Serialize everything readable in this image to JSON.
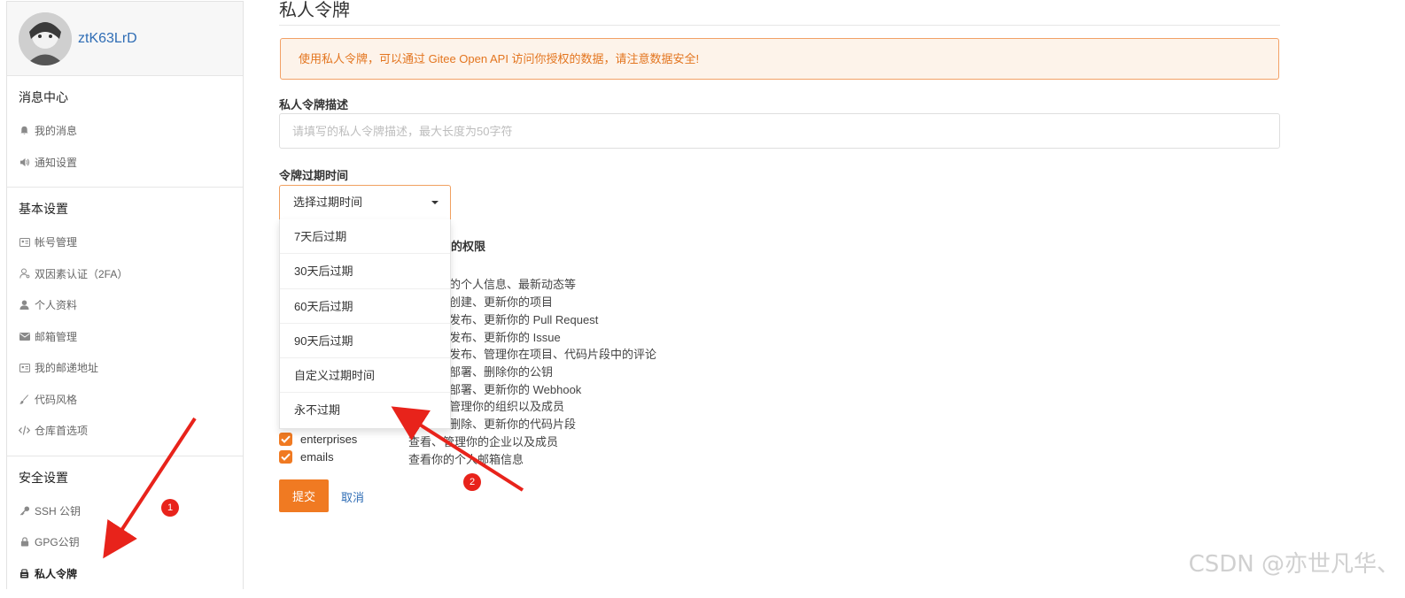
{
  "user": {
    "name": "ztK63LrD"
  },
  "sidebar": {
    "sections": [
      {
        "title": "消息中心",
        "items": [
          {
            "label": "我的消息",
            "icon": "bell-icon"
          },
          {
            "label": "通知设置",
            "icon": "volume-icon"
          }
        ]
      },
      {
        "title": "基本设置",
        "items": [
          {
            "label": "帐号管理",
            "icon": "id-card-icon"
          },
          {
            "label": "双因素认证（2FA）",
            "icon": "user-key-icon"
          },
          {
            "label": "个人资料",
            "icon": "user-icon"
          },
          {
            "label": "邮箱管理",
            "icon": "envelope-icon"
          },
          {
            "label": "我的邮递地址",
            "icon": "address-card-icon"
          },
          {
            "label": "代码风格",
            "icon": "brush-icon"
          },
          {
            "label": "仓库首选项",
            "icon": "code-icon"
          }
        ]
      },
      {
        "title": "安全设置",
        "items": [
          {
            "label": "SSH 公钥",
            "icon": "key-icon"
          },
          {
            "label": "GPG公钥",
            "icon": "lock-icon"
          },
          {
            "label": "私人令牌",
            "icon": "token-icon",
            "active": true
          }
        ]
      }
    ]
  },
  "main": {
    "title": "私人令牌",
    "warning": "使用私人令牌，可以通过 Gitee Open API 访问你授权的数据，请注意数据安全!",
    "desc_label": "私人令牌描述",
    "desc_placeholder": "请填写的私人令牌描述，最大长度为50字符",
    "expire_label": "令牌过期时间",
    "select_value": "选择过期时间",
    "options": [
      "7天后过期",
      "30天后过期",
      "60天后过期",
      "90天后过期",
      "自定义过期时间",
      "永不过期"
    ],
    "perm_title_partial": "有的权限",
    "permissions_partial": [
      {
        "desc": "的个人信息、最新动态等"
      },
      {
        "desc": "创建、更新你的项目"
      },
      {
        "desc": "发布、更新你的 Pull Request"
      },
      {
        "desc": "发布、更新你的 Issue"
      },
      {
        "desc": "发布、管理你在项目、代码片段中的评论"
      },
      {
        "desc": "部署、删除你的公钥"
      },
      {
        "desc": "部署、更新你的 Webhook"
      },
      {
        "desc": "管理你的组织以及成员"
      },
      {
        "desc": "删除、更新你的代码片段"
      }
    ],
    "permissions": [
      {
        "name": "enterprises",
        "desc": "查看、管理你的企业以及成员"
      },
      {
        "name": "emails",
        "desc": "查看你的个人邮箱信息"
      }
    ],
    "submit": "提交",
    "cancel": "取消"
  },
  "annotations": {
    "badge1": "1",
    "badge2": "2",
    "arrow_color": "#e8231b"
  },
  "watermark": "CSDN @亦世凡华、",
  "colors": {
    "accent": "#f07a22",
    "link": "#2f6db5",
    "warning_bg": "#fdf3ea",
    "warning_text": "#e3751f"
  }
}
